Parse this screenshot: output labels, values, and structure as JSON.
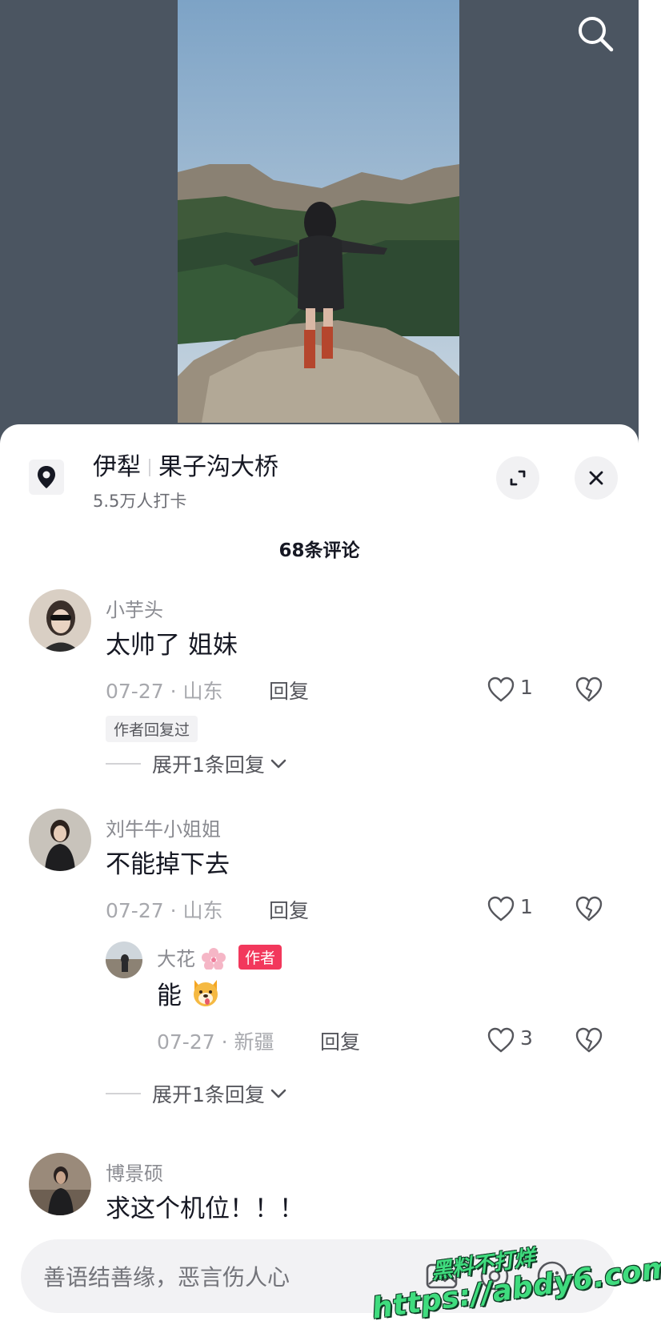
{
  "location": {
    "city": "伊犁",
    "place": "果子沟大桥",
    "checkins": "5.5万人打卡"
  },
  "comments_header": {
    "count_label": "68条评论"
  },
  "comments": [
    {
      "username": "小芋头",
      "text": "太帅了 姐妹",
      "date_region": "07-27 · 山东",
      "reply_label": "回复",
      "likes": "1",
      "author_replied_tag": "作者回复过",
      "expand_label": "展开1条回复"
    },
    {
      "username": "刘牛牛小姐姐",
      "text": "不能掉下去",
      "date_region": "07-27 · 山东",
      "reply_label": "回复",
      "likes": "1",
      "reply": {
        "username": "大花",
        "author_badge": "作者",
        "text": "能",
        "date_region": "07-27 · 新疆",
        "reply_label": "回复",
        "likes": "3"
      },
      "expand_label": "展开1条回复"
    },
    {
      "username": "博景硕",
      "text": "求这个机位！！！"
    }
  ],
  "input": {
    "placeholder": "善语结善缘，恶言伤人心"
  },
  "watermark": {
    "line1": "黑料不打烊",
    "line2": "https://abdy6.com"
  },
  "colors": {
    "author_badge": "#f2385c",
    "watermark": "#3fdc7e",
    "video_background": "#4b5561"
  }
}
